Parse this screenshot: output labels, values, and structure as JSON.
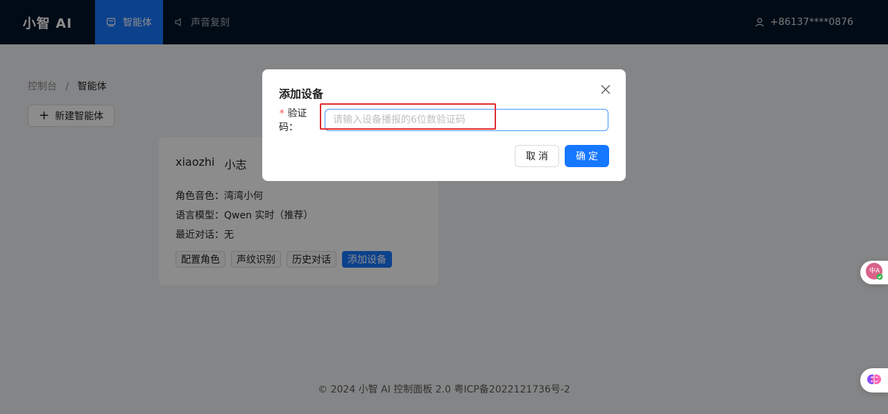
{
  "header": {
    "brand": "小智 AI",
    "nav": [
      {
        "label": "智能体",
        "icon": "robot-icon",
        "active": true
      },
      {
        "label": "声音复刻",
        "icon": "speaker-icon",
        "active": false
      }
    ],
    "user": {
      "icon": "user-icon",
      "phone": "+86137****0876"
    }
  },
  "breadcrumb": {
    "root": "控制台",
    "separator": "/",
    "current": "智能体"
  },
  "new_agent_button": {
    "icon": "plus-icon",
    "label": "新建智能体"
  },
  "agent_card": {
    "name": "xiaozhi",
    "nickname": "小志",
    "rows": [
      {
        "label": "角色音色：",
        "value": "湾湾小何"
      },
      {
        "label": "语言模型：",
        "value": "Qwen 实时（推荐）"
      },
      {
        "label": "最近对话：",
        "value": "无"
      }
    ],
    "actions": [
      "配置角色",
      "声纹识别",
      "历史对话",
      "添加设备"
    ]
  },
  "footer": {
    "text": "© 2024 小智 AI 控制面板 2.0 粤ICP备2022121736号-2"
  },
  "modal": {
    "title": "添加设备",
    "close_icon": "close-icon",
    "field": {
      "required_mark": "*",
      "label": "验证码：",
      "value": "",
      "placeholder": "请输入设备播报的6位数验证码"
    },
    "cancel_label": "取消",
    "ok_label": "确定"
  },
  "floating": [
    {
      "icon": "translate-icon",
      "label": "中A"
    },
    {
      "icon": "brain-icon"
    }
  ],
  "colors": {
    "header_bg": "#001529",
    "primary": "#1677ff",
    "highlight": "#e0282e",
    "required": "#ff4d4f"
  }
}
